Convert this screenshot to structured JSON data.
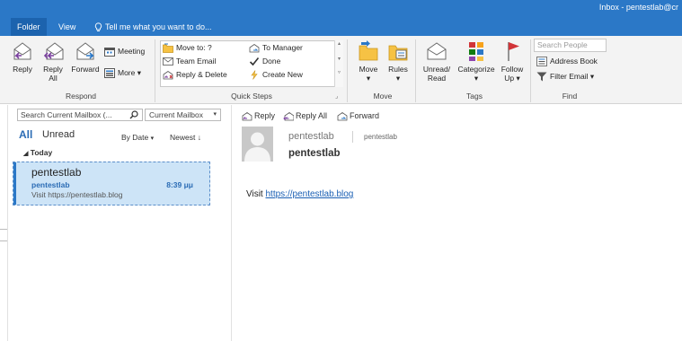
{
  "window": {
    "title": "Inbox - pentestlab@cr"
  },
  "tabs": [
    {
      "label": "Folder"
    },
    {
      "label": "View"
    },
    {
      "label": "Tell me what you want to do..."
    }
  ],
  "ribbon": {
    "respond": {
      "label": "Respond",
      "reply": "Reply",
      "reply_all_1": "Reply",
      "reply_all_2": "All",
      "forward": "Forward",
      "meeting": "Meeting",
      "more": "More"
    },
    "quick_steps": {
      "label": "Quick Steps",
      "items": [
        {
          "label": "Move to: ?"
        },
        {
          "label": "Team Email"
        },
        {
          "label": "Reply & Delete"
        },
        {
          "label": "To Manager"
        },
        {
          "label": "Done"
        },
        {
          "label": "Create New"
        }
      ]
    },
    "move": {
      "label": "Move",
      "move": "Move",
      "rules": "Rules"
    },
    "tags": {
      "label": "Tags",
      "unread_1": "Unread/",
      "unread_2": "Read",
      "categorize": "Categorize",
      "follow_1": "Follow",
      "follow_2": "Up"
    },
    "find": {
      "label": "Find",
      "search_placeholder": "Search People",
      "address_book": "Address Book",
      "filter_email": "Filter Email"
    }
  },
  "message_list": {
    "search_placeholder": "Search Current Mailbox (...",
    "scope": "Current Mailbox",
    "filter_all": "All",
    "filter_unread": "Unread",
    "sort": "By Date",
    "order": "Newest",
    "group": "Today",
    "messages": [
      {
        "from": "pentestlab",
        "subject": "pentestlab",
        "time": "8:39 μμ",
        "preview": "Visit https://pentestlab.blog"
      }
    ]
  },
  "reading_pane": {
    "actions": {
      "reply": "Reply",
      "reply_all": "Reply All",
      "forward": "Forward"
    },
    "sender_name": "pentestlab",
    "sender_email": "pentestlab",
    "subject": "pentestlab",
    "body_prefix": "Visit ",
    "body_link": "https://pentestlab.blog"
  },
  "colors": {
    "accent": "#2b78c7",
    "selection": "#cde4f7",
    "link": "#1a5fb4"
  }
}
